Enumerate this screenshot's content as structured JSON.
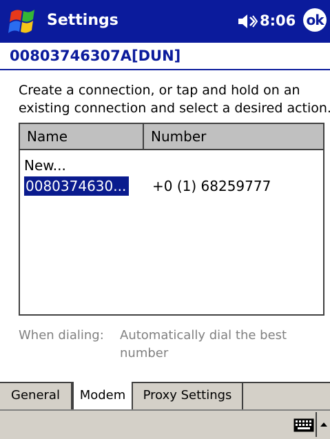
{
  "titlebar": {
    "title": "Settings",
    "time": "8:06",
    "ok_label": "ok",
    "icons": [
      "start-logo-icon",
      "speaker-icon",
      "ok-icon"
    ]
  },
  "connection": {
    "header": "00803746307A[DUN]",
    "instructions_line1": "Create a connection, or tap and hold on an",
    "instructions_line2": "existing connection and select a desired action."
  },
  "list": {
    "columns": [
      "Name",
      "Number"
    ],
    "rows": [
      {
        "name": "New...",
        "number": ""
      },
      {
        "name": "0080374630...",
        "number": "+0 (1) 68259777"
      }
    ]
  },
  "dialing": {
    "label": "When dialing:",
    "value_line1": "Automatically dial the best",
    "value_line2": "number"
  },
  "tabs": [
    "General",
    "Modem",
    "Proxy Settings"
  ],
  "active_tab": "Modem",
  "colors": {
    "titlebar": "#0b1b9c",
    "accent": "#0b1b9c",
    "selection": "#0a1b8e",
    "disabled_text": "#808080"
  }
}
